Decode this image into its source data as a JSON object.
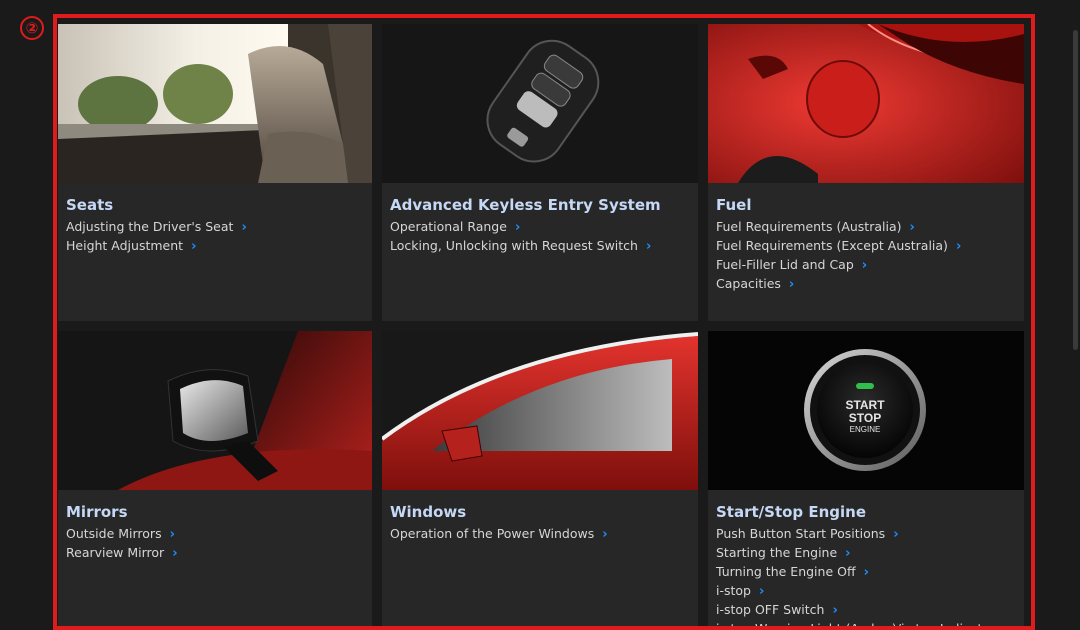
{
  "marker_label": "②",
  "cards": [
    {
      "title": "Seats",
      "image": "car-seat-image",
      "links": [
        "Adjusting the Driver's Seat",
        "Height Adjustment"
      ]
    },
    {
      "title": "Advanced Keyless Entry System",
      "image": "key-fob-image",
      "links": [
        "Operational Range",
        "Locking, Unlocking with Request Switch"
      ]
    },
    {
      "title": "Fuel",
      "image": "fuel-lid-image",
      "links": [
        "Fuel Requirements (Australia)",
        "Fuel Requirements (Except Australia)",
        "Fuel-Filler Lid and Cap",
        "Capacities"
      ]
    },
    {
      "title": "Mirrors",
      "image": "side-mirror-image",
      "links": [
        "Outside Mirrors",
        "Rearview Mirror"
      ]
    },
    {
      "title": "Windows",
      "image": "car-window-image",
      "links": [
        "Operation of the Power Windows"
      ]
    },
    {
      "title": "Start/Stop Engine",
      "image": "start-button-image",
      "button_text": [
        "START",
        "STOP",
        "ENGINE"
      ],
      "links": [
        "Push Button Start Positions",
        "Starting the Engine",
        "Turning the Engine Off",
        "i-stop",
        "i-stop OFF Switch",
        "i-stop Warning Light (Amber)/i-stop Indicator"
      ]
    }
  ],
  "colors": {
    "highlight": "#e01b1b",
    "chevron": "#1e8fff",
    "card_bg": "#272727"
  }
}
